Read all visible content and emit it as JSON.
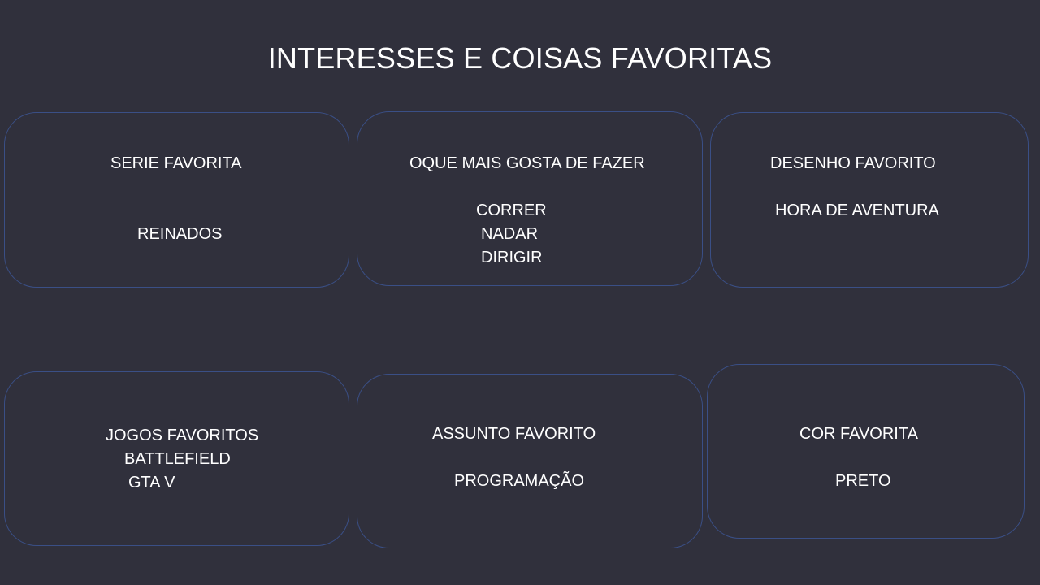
{
  "title": "INTERESSES E COISAS FAVORITAS",
  "cards": [
    {
      "heading": "SERIE FAVORITA",
      "items": [
        "REINADOS"
      ]
    },
    {
      "heading": "OQUE MAIS GOSTA DE FAZER",
      "items": [
        "CORRER",
        "NADAR",
        "DIRIGIR"
      ]
    },
    {
      "heading": "DESENHO FAVORITO",
      "items": [
        "HORA DE AVENTURA"
      ]
    },
    {
      "heading": "JOGOS FAVORITOS",
      "items": [
        "BATTLEFIELD",
        "GTA V"
      ]
    },
    {
      "heading": "ASSUNTO FAVORITO",
      "items": [
        "PROGRAMAÇÃO"
      ]
    },
    {
      "heading": "COR FAVORITA",
      "items": [
        "PRETO"
      ]
    }
  ],
  "colors": {
    "background": "#30303c",
    "card_border": "#3a4f86",
    "text": "#ffffff"
  }
}
